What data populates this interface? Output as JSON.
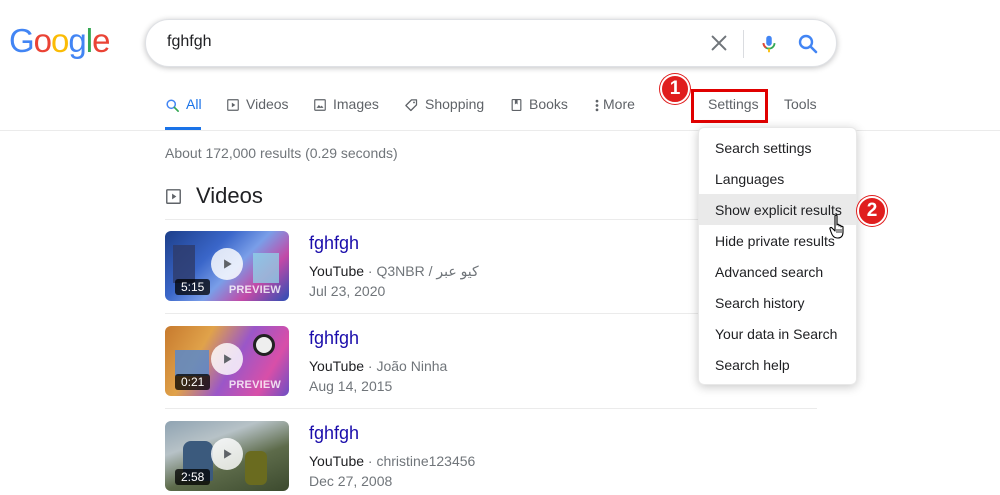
{
  "logo": {
    "text": "Google"
  },
  "search": {
    "query": "fghfgh"
  },
  "tabs": [
    {
      "label": "All",
      "icon": "search-icon",
      "active": true
    },
    {
      "label": "Videos",
      "icon": "video-icon"
    },
    {
      "label": "Images",
      "icon": "image-icon"
    },
    {
      "label": "Shopping",
      "icon": "tag-icon"
    },
    {
      "label": "Books",
      "icon": "book-icon"
    },
    {
      "label": "More",
      "icon": "more-vert-icon"
    },
    {
      "label": "Settings"
    },
    {
      "label": "Tools"
    }
  ],
  "annotations": {
    "step1": "1",
    "step2": "2"
  },
  "stats": "About 172,000 results (0.29 seconds)",
  "videos_section": {
    "title": "Videos",
    "items": [
      {
        "title": "fghfgh",
        "source": "YouTube",
        "channel": "Q3NBR / كيو عبر",
        "date": "Jul 23, 2020",
        "duration": "5:15",
        "preview": "PREVIEW"
      },
      {
        "title": "fghfgh",
        "source": "YouTube",
        "channel": "João Ninha",
        "date": "Aug 14, 2015",
        "duration": "0:21",
        "preview": "PREVIEW"
      },
      {
        "title": "fghfgh",
        "source": "YouTube",
        "channel": "christine123456",
        "date": "Dec 27, 2008",
        "duration": "2:58"
      }
    ]
  },
  "settings_menu": {
    "items": [
      "Search settings",
      "Languages",
      "Show explicit results",
      "Hide private results",
      "Advanced search",
      "Search history",
      "Your data in Search",
      "Search help"
    ],
    "hovered": "Show explicit results"
  },
  "colors": {
    "link": "#1a0dab",
    "accent": "#1a73e8",
    "annotation": "#e01e1e"
  }
}
